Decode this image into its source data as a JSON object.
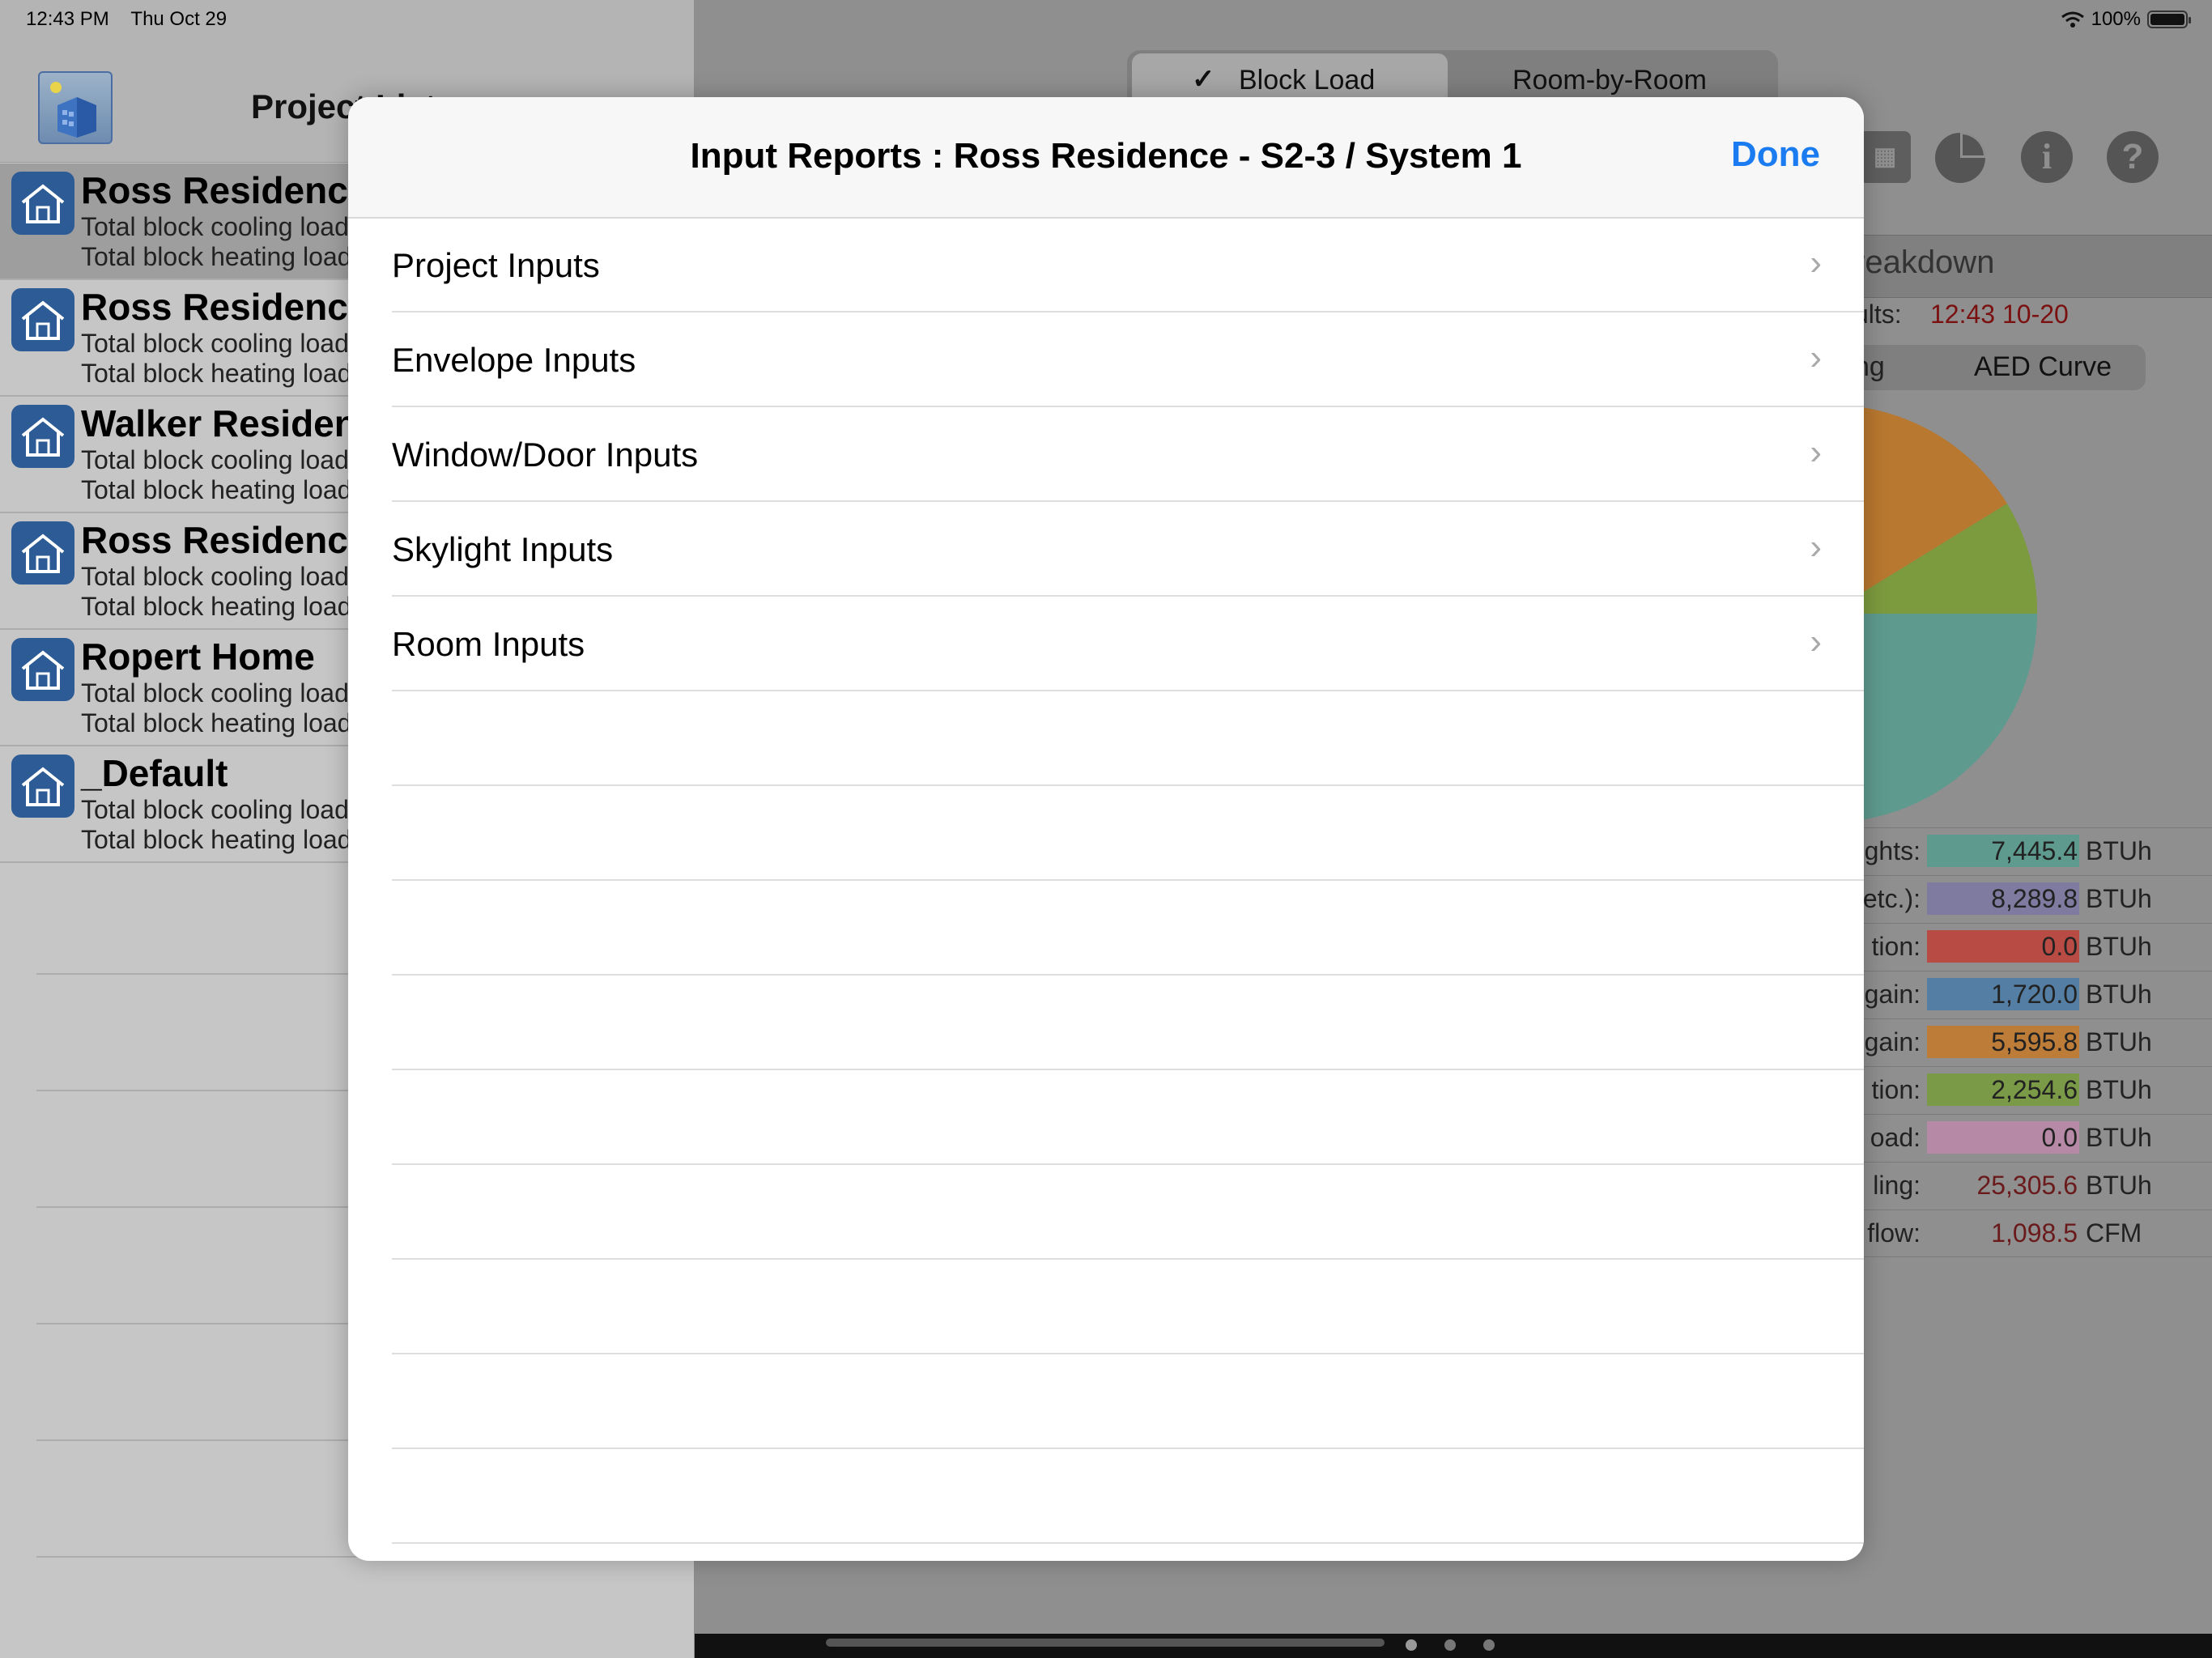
{
  "status_bar": {
    "time": "12:43 PM",
    "date": "Thu Oct 29",
    "battery": "100%"
  },
  "left_panel": {
    "title": "Project List",
    "projects": [
      {
        "name": "Ross Residence",
        "line1": "Total block cooling load",
        "line2": "Total block heating load",
        "selected": true
      },
      {
        "name": "Ross Residence",
        "line1": "Total block cooling load",
        "line2": "Total block heating load",
        "selected": false
      },
      {
        "name": "Walker Residence",
        "line1": "Total block cooling load",
        "line2": "Total block heating load",
        "selected": false
      },
      {
        "name": "Ross Residence",
        "line1": "Total block cooling load",
        "line2": "Total block heating load",
        "selected": false
      },
      {
        "name": "Ropert Home",
        "line1": "Total block cooling load",
        "line2": "Total block heating load",
        "selected": false
      },
      {
        "name": "_Default",
        "line1": "Total block cooling load",
        "line2": "Total block heating load",
        "selected": false
      }
    ]
  },
  "right_panel": {
    "tabs": {
      "block_load": "Block Load",
      "room_by_room": "Room-by-Room",
      "check": "✓"
    },
    "breakdown_title": "reakdown",
    "results_label": "ults:",
    "results_value": "12:43 10-20",
    "seg_a": "ng",
    "seg_b": "AED Curve",
    "legend": [
      {
        "label": "ghts:",
        "value": "7,445.4",
        "unit": "BTUh",
        "color": "#5e9a8e"
      },
      {
        "label": "etc.):",
        "value": "8,289.8",
        "unit": "BTUh",
        "color": "#7e7aa0"
      },
      {
        "label": "tion:",
        "value": "0.0",
        "unit": "BTUh",
        "color": "#b84c44"
      },
      {
        "label": "gain:",
        "value": "1,720.0",
        "unit": "BTUh",
        "color": "#547ea4"
      },
      {
        "label": "gain:",
        "value": "5,595.8",
        "unit": "BTUh",
        "color": "#bd7d38"
      },
      {
        "label": "tion:",
        "value": "2,254.6",
        "unit": "BTUh",
        "color": "#7a9a48"
      },
      {
        "label": "oad:",
        "value": "0.0",
        "unit": "BTUh",
        "color": "#b68aa6"
      },
      {
        "label": "ling:",
        "value": "25,305.6",
        "unit": "BTUh",
        "color": ""
      },
      {
        "label": "flow:",
        "value": "1,098.5",
        "unit": "CFM",
        "color": ""
      }
    ],
    "pie_colors": {
      "orange": "#b8782f",
      "green": "#7c9a3e",
      "teal": "#5e9a8e"
    }
  },
  "modal": {
    "title": "Input Reports : Ross Residence - S2-3 / System 1",
    "done_label": "Done",
    "rows": [
      {
        "label": "Project Inputs"
      },
      {
        "label": "Envelope Inputs"
      },
      {
        "label": "Window/Door Inputs"
      },
      {
        "label": "Skylight Inputs"
      },
      {
        "label": "Room Inputs"
      }
    ]
  }
}
